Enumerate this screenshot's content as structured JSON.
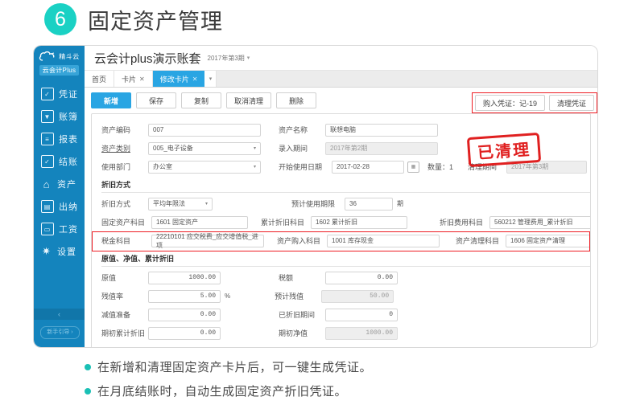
{
  "page": {
    "number": "6",
    "title": "固定资产管理"
  },
  "app": {
    "logo_name": "精斗云",
    "logo_badge": "云会计Plus",
    "book_title": "云会计plus演示账套",
    "period": "2017年第3期",
    "period_caret": "▾"
  },
  "sidebar": {
    "items": [
      {
        "label": "凭证",
        "icon": "voucher-icon",
        "glyph": "☑"
      },
      {
        "label": "账簿",
        "icon": "book-icon",
        "glyph": "▼"
      },
      {
        "label": "报表",
        "icon": "report-icon",
        "glyph": "☰"
      },
      {
        "label": "结账",
        "icon": "checkout-icon",
        "glyph": "✓"
      },
      {
        "label": "资产",
        "icon": "asset-icon",
        "glyph": "⌂"
      },
      {
        "label": "出纳",
        "icon": "cashier-icon",
        "glyph": "▤"
      },
      {
        "label": "工资",
        "icon": "salary-icon",
        "glyph": "▭"
      },
      {
        "label": "设置",
        "icon": "gear-icon",
        "glyph": "✿"
      }
    ],
    "collapse": "‹",
    "guide_button": "新手引导 ›"
  },
  "tabs": [
    {
      "label": "首页",
      "closable": false,
      "active": false
    },
    {
      "label": "卡片",
      "closable": true,
      "active": false
    },
    {
      "label": "修改卡片",
      "closable": true,
      "active": true
    }
  ],
  "tab_more": "▾",
  "toolbar": {
    "buttons": [
      {
        "label": "新增",
        "primary": true
      },
      {
        "label": "保存",
        "primary": false
      },
      {
        "label": "复制",
        "primary": false
      },
      {
        "label": "取消清理",
        "primary": false
      },
      {
        "label": "删除",
        "primary": false
      }
    ],
    "right_buttons": [
      {
        "label": "购入凭证：记-19"
      },
      {
        "label": "清理凭证"
      }
    ]
  },
  "stamp": "已清理",
  "form": {
    "asset_code_label": "资产编码",
    "asset_code_value": "007",
    "asset_name_label": "资产名称",
    "asset_name_value": "联想电脑",
    "asset_type_label": "资产类别",
    "asset_type_value": "005_电子设备",
    "entry_period_label": "录入期间",
    "entry_period_value": "2017年第2期",
    "department_label": "使用部门",
    "department_value": "办公室",
    "start_date_label": "开始使用日期",
    "start_date_value": "2017-02-28",
    "quantity_label": "数量：1",
    "clear_period_label": "清理期间",
    "clear_period_value": "2017年第3期",
    "section_depreciation": "折旧方式",
    "dep_method_label": "折旧方式",
    "dep_method_value": "平均年限法",
    "dep_life_label": "预计使用期限",
    "dep_life_value": "36",
    "dep_life_unit": "期",
    "fixed_asset_subject_label": "固定资产科目",
    "fixed_asset_subject_value": "1601 固定资产",
    "accum_dep_subject_label": "累计折旧科目",
    "accum_dep_subject_value": "1602 累计折旧",
    "dep_expense_subject_label": "折旧费用科目",
    "dep_expense_subject_value": "560212 管理费用_累计折旧",
    "tax_subject_label": "税金科目",
    "tax_subject_value": "22210101 应交税费_应交增值税_进项",
    "purchase_subject_label": "资产购入科目",
    "purchase_subject_value": "1001 库存现金",
    "clearance_subject_label": "资产清理科目",
    "clearance_subject_value": "1606 固定资产清理",
    "section_value": "原值、净值、累计折旧",
    "original_value_label": "原值",
    "original_value": "1000.00",
    "tax_amount_label": "税额",
    "tax_amount_value": "0.00",
    "salvage_rate_label": "残值率",
    "salvage_rate_value": "5.00",
    "salvage_rate_unit": "%",
    "expected_salvage_label": "预计残值",
    "expected_salvage_value": "50.00",
    "impairment_label": "减值准备",
    "impairment_value": "0.00",
    "depreciated_period_label": "已折旧期间",
    "depreciated_period_value": "0",
    "begin_accum_dep_label": "期初累计折旧",
    "begin_accum_dep_value": "0.00",
    "begin_net_label": "期初净值",
    "begin_net_value": "1000.00"
  },
  "notes": [
    "在新增和清理固定资产卡片后，可一键生成凭证。",
    "在月底结账时，自动生成固定资产折旧凭证。"
  ],
  "colors": {
    "teal": "#1ad1c4",
    "sidebar_blue": "#1484bd",
    "accent_blue": "#29a5e3",
    "red": "#ee1c23"
  }
}
